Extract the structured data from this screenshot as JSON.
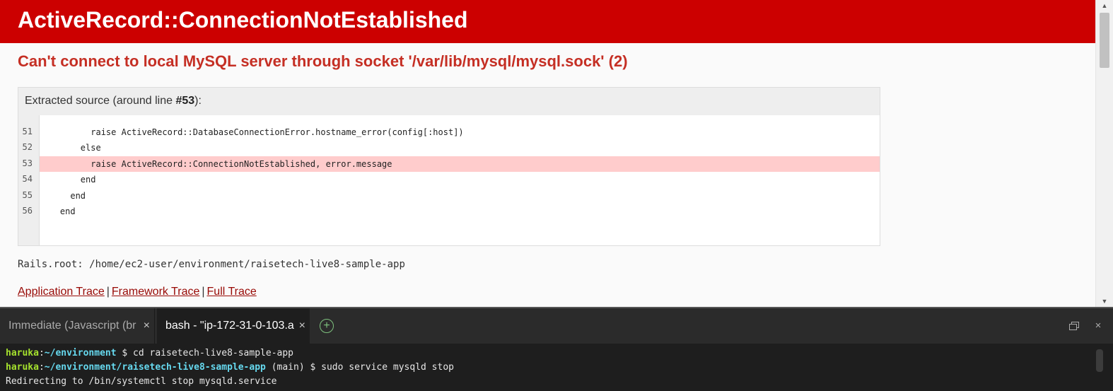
{
  "browser": {
    "error_title": "ActiveRecord::ConnectionNotEstablished",
    "error_message": "Can't connect to local MySQL server through socket '/var/lib/mysql/mysql.sock' (2)",
    "source": {
      "title_prefix": "Extracted source (around line ",
      "title_line": "#53",
      "title_suffix": "):",
      "lines": [
        {
          "num": "51",
          "code": "          raise ActiveRecord::DatabaseConnectionError.hostname_error(config[:host])",
          "highlight": false
        },
        {
          "num": "52",
          "code": "        else",
          "highlight": false
        },
        {
          "num": "53",
          "code": "          raise ActiveRecord::ConnectionNotEstablished, error.message",
          "highlight": true
        },
        {
          "num": "54",
          "code": "        end",
          "highlight": false
        },
        {
          "num": "55",
          "code": "      end",
          "highlight": false
        },
        {
          "num": "56",
          "code": "    end",
          "highlight": false
        }
      ]
    },
    "rails_root": "Rails.root: /home/ec2-user/environment/raisetech-live8-sample-app",
    "trace_links": {
      "application": "Application Trace",
      "framework": "Framework Trace",
      "full": "Full Trace",
      "separator": "|"
    }
  },
  "terminal": {
    "tabs": [
      {
        "label": "Immediate (Javascript (br",
        "close": "×"
      },
      {
        "label": "bash - \"ip-172-31-0-103.a",
        "close": "×"
      }
    ],
    "add_tab_glyph": "+",
    "close_panel_glyph": "×",
    "lines": [
      {
        "user": "haruka",
        "sep": ":",
        "path": "~/environment",
        "rest": " $ cd raisetech-live8-sample-app"
      },
      {
        "user": "haruka",
        "sep": ":",
        "path": "~/environment/raisetech-live8-sample-app",
        "rest": " (main) $ sudo service mysqld stop"
      },
      {
        "plain": "Redirecting to /bin/systemctl stop mysqld.service"
      }
    ]
  },
  "colors": {
    "header_bg": "#cc0000",
    "error_message": "#c52f24",
    "link": "#980905",
    "highlight_line": "#ffcccc",
    "terminal_bg": "#1e1e1e",
    "prompt_user": "#a6e22e",
    "prompt_path": "#66d9ef"
  },
  "icons": {
    "scroll_up": "triangle-up",
    "scroll_down": "triangle-down",
    "add_tab": "plus-circle",
    "maximize": "restore-window",
    "close": "x-mark"
  }
}
